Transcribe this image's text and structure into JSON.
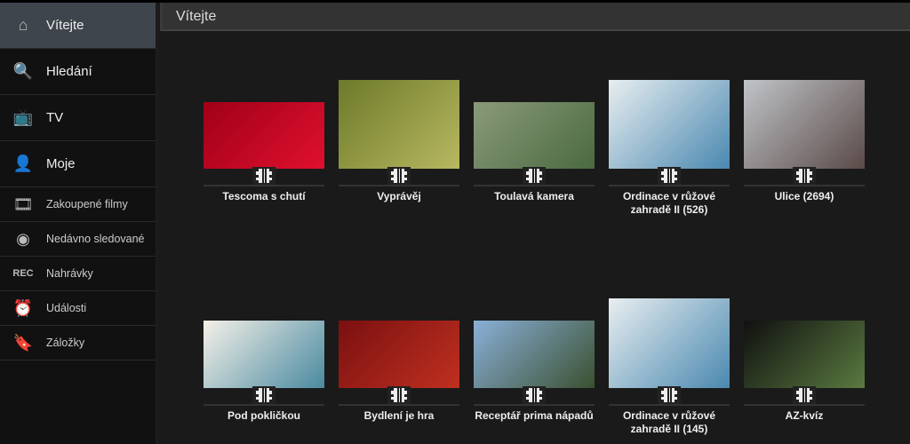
{
  "header": {
    "title": "Vítejte"
  },
  "sidebar": {
    "items": [
      {
        "label": "Vítejte",
        "icon": "home-icon",
        "glyph": "⌂",
        "selected": true,
        "size": "big"
      },
      {
        "label": "Hledání",
        "icon": "search-icon",
        "glyph": "🔍",
        "size": "big"
      },
      {
        "label": "TV",
        "icon": "tv-icon",
        "glyph": "📺",
        "size": "big"
      },
      {
        "label": "Moje",
        "icon": "user-icon",
        "glyph": "👤",
        "size": "big"
      },
      {
        "label": "Zakoupené filmy",
        "icon": "film-icon",
        "glyph": "🎞",
        "size": "small"
      },
      {
        "label": "Nedávno sledované",
        "icon": "recent-icon",
        "glyph": "◉",
        "size": "small"
      },
      {
        "label": "Nahrávky",
        "icon": "rec-icon",
        "glyph": "REC",
        "size": "small"
      },
      {
        "label": "Události",
        "icon": "alarm-clock-icon",
        "glyph": "⏰",
        "size": "small"
      },
      {
        "label": "Záložky",
        "icon": "bookmark-icon",
        "glyph": "🔖",
        "size": "small"
      }
    ]
  },
  "items": [
    {
      "title": "Tescoma s chutí",
      "colors": [
        "#a00018",
        "#e0102e"
      ]
    },
    {
      "title": "Vyprávěj",
      "colors": [
        "#6d7a2a",
        "#b8b860"
      ]
    },
    {
      "title": "Toulavá kamera",
      "colors": [
        "#8a9a7a",
        "#4a6a40"
      ]
    },
    {
      "title": "Ordinace v růžové zahradě II (526)",
      "colors": [
        "#e8eef0",
        "#4a88b0"
      ]
    },
    {
      "title": "Ulice (2694)",
      "colors": [
        "#c0c4c8",
        "#5a4a48"
      ]
    },
    {
      "title": "Pod pokličkou",
      "colors": [
        "#f4f0e8",
        "#4a8aa0"
      ]
    },
    {
      "title": "Bydlení je hra",
      "colors": [
        "#7a1010",
        "#c03020"
      ]
    },
    {
      "title": "Receptář prima nápadů",
      "colors": [
        "#8ab0d8",
        "#3a5030"
      ]
    },
    {
      "title": "Ordinace v růžové zahradě II (145)",
      "colors": [
        "#e8eef0",
        "#4a88b0"
      ]
    },
    {
      "title": "AZ-kvíz",
      "colors": [
        "#101010",
        "#5a7a40"
      ]
    }
  ]
}
